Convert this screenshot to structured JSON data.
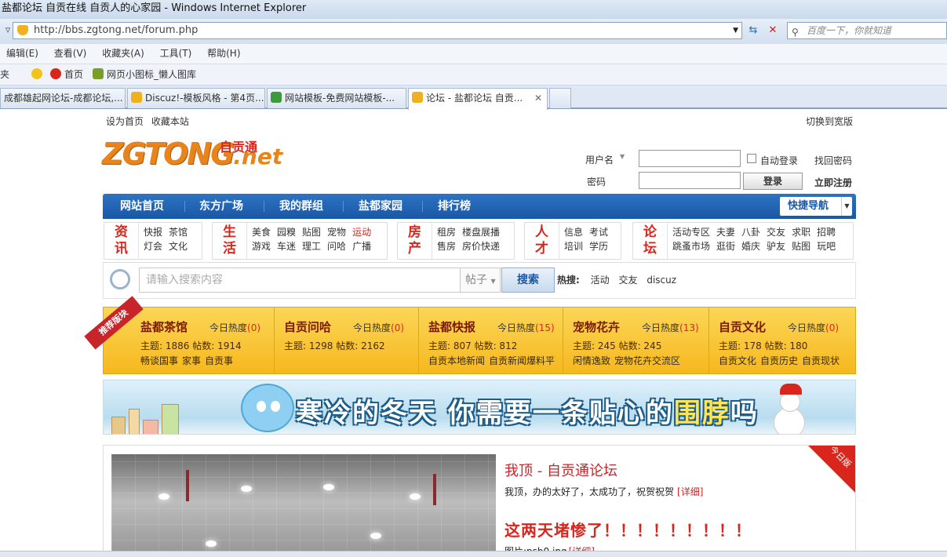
{
  "window": {
    "title": "盐都论坛 自贡在线 自贡人的心家园 - Windows Internet Explorer"
  },
  "address": {
    "url": "http://bbs.zgtong.net/forum.php",
    "search_placeholder": "百度一下，你就知道"
  },
  "menu": [
    "编辑(E)",
    "查看(V)",
    "收藏夹(A)",
    "工具(T)",
    "帮助(H)"
  ],
  "favbar": {
    "fav_cut": "夹",
    "home": "首页",
    "icons": "网页小图标_懒人图库"
  },
  "tabs": [
    {
      "label": "成都雄起网论坛-成都论坛,..."
    },
    {
      "label": "Discuz!-模板风格 - 第4页..."
    },
    {
      "label": "网站模板-免费网站模板-..."
    },
    {
      "label": "论坛 - 盐都论坛 自贡..."
    }
  ],
  "toplinks": {
    "sethome": "设为首页",
    "bookmark": "收藏本站",
    "wide": "切换到宽版"
  },
  "logo": {
    "main": "ZGTONG",
    "net": ".net",
    "cn": "自贡通"
  },
  "login": {
    "username": "用户名",
    "password": "密码",
    "auto": "自动登录",
    "forgot": "找回密码",
    "submit": "登录",
    "register": "立即注册"
  },
  "mainnav": [
    "网站首页",
    "东方广场",
    "我的群组",
    "盐都家园",
    "排行榜"
  ],
  "quicknav": "快捷导航",
  "categories": [
    {
      "head": [
        "资",
        "讯"
      ],
      "links": [
        [
          "快报",
          "茶馆"
        ],
        [
          "灯会",
          "文化"
        ]
      ]
    },
    {
      "head": [
        "生",
        "活"
      ],
      "links": [
        [
          "美食",
          "园糗",
          "贴图",
          "宠物",
          "运动"
        ],
        [
          "游戏",
          "车迷",
          "理工",
          "问哈",
          "广播"
        ]
      ]
    },
    {
      "head": [
        "房",
        "产"
      ],
      "links": [
        [
          "租房",
          "楼盘展播"
        ],
        [
          "售房",
          "房价快递"
        ]
      ]
    },
    {
      "head": [
        "人",
        "才"
      ],
      "links": [
        [
          "信息",
          "考试"
        ],
        [
          "培训",
          "学历"
        ]
      ]
    },
    {
      "head": [
        "论",
        "坛"
      ],
      "links": [
        [
          "活动专区",
          "夫妻",
          "八卦",
          "交友",
          "求职",
          "招聘"
        ],
        [
          "跳蚤市场",
          "逛街",
          "婚庆",
          "驴友",
          "贴图",
          "玩吧"
        ]
      ]
    }
  ],
  "search": {
    "placeholder": "请输入搜索内容",
    "type": "帖子",
    "button": "搜索",
    "hot_label": "热搜:",
    "hot": [
      "活动",
      "交友",
      "discuz"
    ]
  },
  "recommend": {
    "ribbon": "推荐版块",
    "boards": [
      {
        "name": "盐都茶馆",
        "heat_label": "今日热度",
        "heat": "(0)",
        "stats": "主题: 1886 帖数: 1914",
        "subs": [
          "畅谈国事",
          "家事",
          "自贡事"
        ]
      },
      {
        "name": "自贡问哈",
        "heat_label": "今日热度",
        "heat": "(0)",
        "stats": "主题: 1298 帖数: 2162",
        "subs": []
      },
      {
        "name": "盐都快报",
        "heat_label": "今日热度",
        "heat": "(15)",
        "stats": "主题: 807 帖数: 812",
        "subs": [
          "自贡本地新闻",
          "自贡新闻爆料平"
        ]
      },
      {
        "name": "宠物花卉",
        "heat_label": "今日热度",
        "heat": "(13)",
        "stats": "主题: 245 帖数: 245",
        "subs": [
          "闲情逸致",
          "宠物花卉交流区"
        ]
      },
      {
        "name": "自贡文化",
        "heat_label": "今日热度",
        "heat": "(0)",
        "stats": "主题: 178 帖数: 180",
        "subs": [
          "自贡文化",
          "自贡历史",
          "自贡现状"
        ]
      }
    ]
  },
  "banner": {
    "text1": "寒冷的冬天  你需要一条贴心的",
    "text2": "围脖",
    "text3": "吗"
  },
  "article": {
    "corner": "今日版",
    "title1": "我顶 - 自贡通论坛",
    "desc1": "我顶，办的太好了，太成功了，祝贺祝贺",
    "more": "[详细]",
    "title2": "这两天堵惨了！！！！！！！！！",
    "desc2": "图片:psb0.jpg",
    "more2": "[详细]"
  }
}
